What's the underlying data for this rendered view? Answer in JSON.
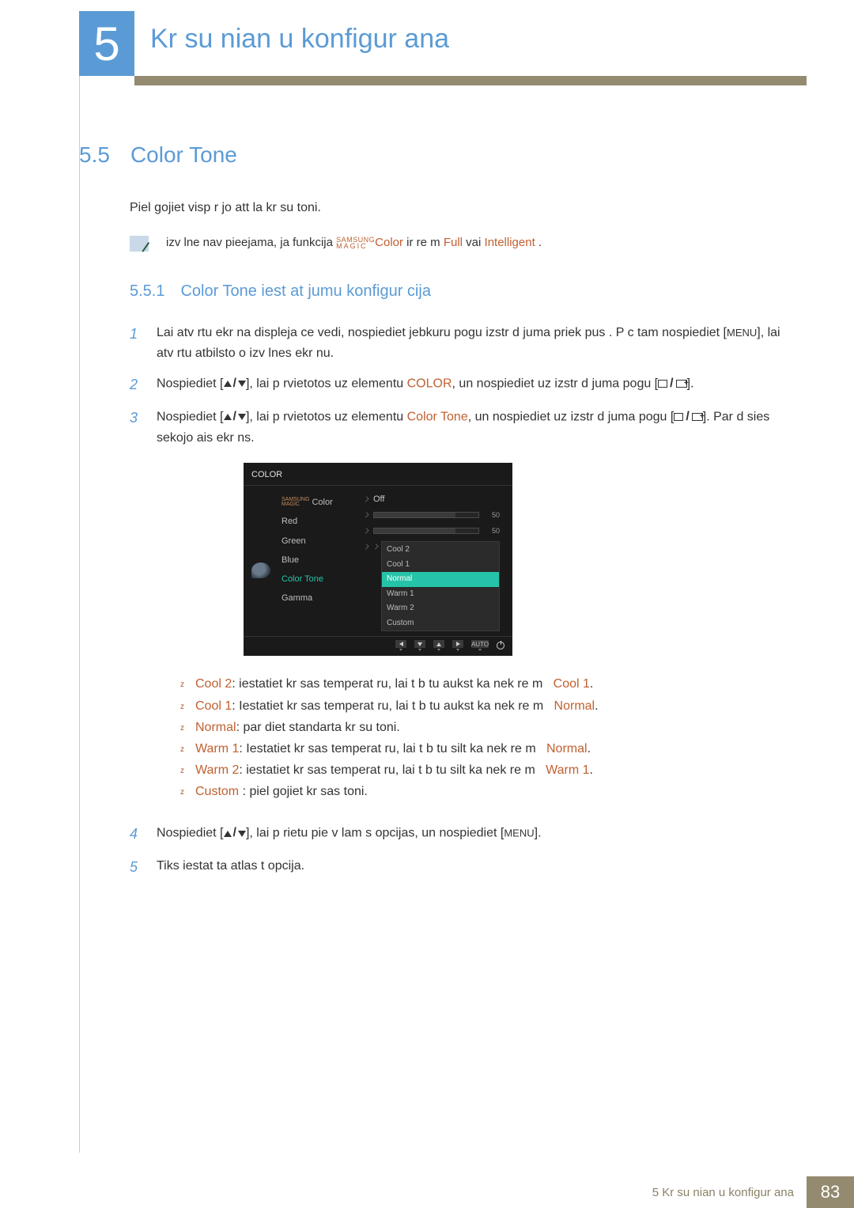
{
  "chapter": {
    "number": "5",
    "title": "Kr su nian u konfigur ana"
  },
  "section": {
    "number": "5.5",
    "title": "Color Tone"
  },
  "intro": "Piel gojiet visp r jo att la kr su toni.",
  "note": {
    "pre": "izv lne nav pieejama, ja funkcija",
    "brand_top": "SAMSUNG",
    "brand_bot": "MAGIC",
    "color": "Color",
    "mid": " ir re m ",
    "full": "Full",
    "or": " vai ",
    "intelligent": "Intelligent",
    "end": " ."
  },
  "subsection": {
    "number": "5.5.1",
    "title": "Color Tone iest at jumu konfigur cija"
  },
  "steps": {
    "s1": {
      "a": "Lai atv rtu ekr na displeja ce vedi, nospiediet jebkuru pogu izstr d juma priek pus . P c tam nospiediet [",
      "menu": "MENU",
      "b": "], lai atv rtu atbilsto o izv lnes ekr nu."
    },
    "s2": {
      "a": "Nospiediet [",
      "b": "], lai p rvietotos uz elementu",
      "kw": "COLOR",
      "c": ", un nospiediet uz izstr d juma pogu [",
      "d": "]."
    },
    "s3": {
      "a": "Nospiediet [",
      "b": "], lai p rvietotos uz elementu",
      "kw": "Color Tone",
      "c": ", un nospiediet uz izstr d juma pogu [",
      "d": "]. Par d sies sekojo ais ekr ns."
    },
    "s4": {
      "a": "Nospiediet [",
      "b": "], lai p rietu pie v lam s opcijas, un nospiediet [",
      "menu": "MENU",
      "c": "]."
    },
    "s5": "Tiks iestat ta atlas t  opcija."
  },
  "osd": {
    "title": "COLOR",
    "labels": {
      "magic_top": "SAMSUNG",
      "magic_bot": "MAGIC",
      "magic_color": " Color",
      "red": "Red",
      "green": "Green",
      "blue": "Blue",
      "color_tone": "Color Tone",
      "gamma": "Gamma"
    },
    "off": "Off",
    "val_red": "50",
    "val_green": "50",
    "dropdown": [
      "Cool 2",
      "Cool 1",
      "Normal",
      "Warm 1",
      "Warm 2",
      "Custom"
    ],
    "auto": "AUTO"
  },
  "bullets": {
    "b1": {
      "kw": "Cool 2",
      "txt": ": iestatiet kr sas temperat ru, lai t  b tu aukst ka nek  re m  ",
      "ref": "Cool 1",
      "end": "."
    },
    "b2": {
      "kw": "Cool 1",
      "txt": ": Iestatiet kr sas temperat ru, lai t  b tu aukst ka nek  re m  ",
      "ref": "Normal",
      "end": "."
    },
    "b3": {
      "kw": "Normal",
      "txt": ": par diet standarta kr su toni."
    },
    "b4": {
      "kw": "Warm 1",
      "txt": ": Iestatiet kr sas temperat ru, lai t  b tu silt ka nek  re m  ",
      "ref": "Normal",
      "end": "."
    },
    "b5": {
      "kw": "Warm 2",
      "txt": ": iestatiet kr sas temperat ru, lai t  b tu silt ka nek  re m  ",
      "ref": "Warm 1",
      "end": "."
    },
    "b6": {
      "kw": "Custom",
      "txt": " : piel gojiet kr sas toni."
    }
  },
  "footer": {
    "text": "5 Kr su nian u konfigur ana",
    "page": "83"
  }
}
